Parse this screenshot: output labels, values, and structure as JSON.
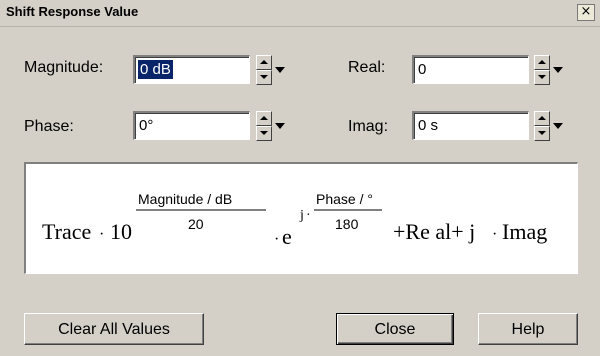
{
  "window": {
    "title": "Shift Response Value",
    "close_glyph": "×"
  },
  "fields": {
    "magnitude": {
      "label": "Magnitude:",
      "value": "0 dB"
    },
    "phase": {
      "label": "Phase:",
      "value": "0°"
    },
    "real": {
      "label": "Real:",
      "value": "0"
    },
    "imag": {
      "label": "Imag:",
      "value": "0 s"
    }
  },
  "formula": {
    "trace": "Trace",
    "dot": "·",
    "ten": "10",
    "mag_num": "Magnitude  / dB",
    "mag_den": "20",
    "e": "e",
    "j": "j",
    "phase_num": "Phase / °",
    "phase_den": "180",
    "tail": "+Re al+ j",
    "imag": "Imag"
  },
  "buttons": {
    "clear": "Clear All Values",
    "close": "Close",
    "help": "Help"
  },
  "icons": {
    "spin": "spin-up-down-icon",
    "dropdown": "dropdown-arrow-icon",
    "close": "close-icon"
  }
}
